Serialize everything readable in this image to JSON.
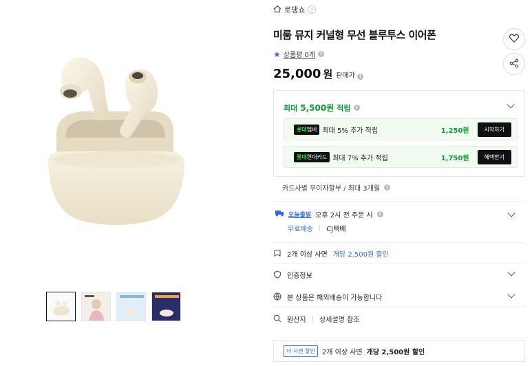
{
  "breadcrumb": {
    "store": "로댕쇼"
  },
  "product": {
    "title": "미룸 뮤지 커널형 무선 블루투스 이어폰",
    "rating_label": "상품평 0개",
    "price": "25,000",
    "price_unit": "원",
    "price_label": "판매가"
  },
  "rewards": {
    "prefix": "최대",
    "amount": "5,500원",
    "suffix": "적립",
    "rows": [
      {
        "badge_left": "롯데",
        "badge_right": "멤버",
        "text": "최대 5% 추가 적립",
        "amount": "1,250원",
        "action": "시작하기"
      },
      {
        "badge_left": "롯데",
        "badge_right": "현대카드",
        "text": "최대 7% 추가 적립",
        "amount": "1,750원",
        "action": "혜택받기"
      }
    ],
    "card_installment": "카드사별 무이자할부 / 최대 3개월"
  },
  "shipping": {
    "today_badge": "오늘출발",
    "time_text": "오후 2시 전 주문 시",
    "free": "무료배송",
    "carrier": "CJ택배"
  },
  "info_rows": [
    {
      "icon": "discount-tag-icon",
      "text": "2개 이상 사면",
      "highlight": "개당 2,500원 할인"
    },
    {
      "icon": "certificate-icon",
      "text": "인증정보"
    },
    {
      "icon": "globe-icon",
      "text": "본 상품은 해외배송이 가능합니다"
    },
    {
      "icon": "origin-search-icon",
      "text": "원산지",
      "extra": "상세설명 참조"
    }
  ],
  "promo": {
    "tag": "더 사면 할인",
    "text": "2개 이상 사면",
    "bold": "개당 2,500원 할인"
  },
  "colors": {
    "accent_blue": "#2f6de1",
    "reward_green": "#0a9d2f",
    "product_cream": "#f1ead6"
  }
}
